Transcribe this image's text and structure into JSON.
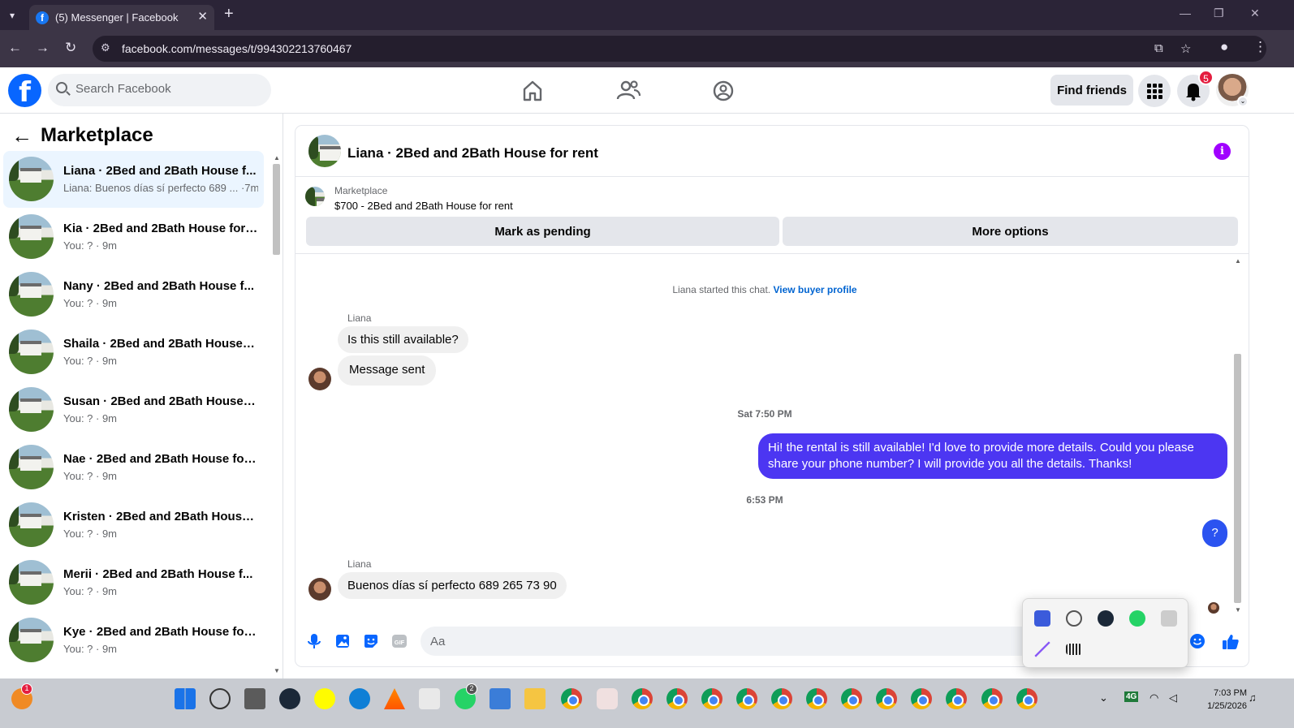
{
  "browser": {
    "tab_title": "(5) Messenger | Facebook",
    "tab_close": "✕",
    "new_tab": "+",
    "url": "facebook.com/messages/t/994302213760467"
  },
  "fb": {
    "logo": "f",
    "search_placeholder": "Search Facebook",
    "find_friends": "Find friends",
    "notif_count": "5"
  },
  "sidebar": {
    "title": "Marketplace",
    "conversations": [
      {
        "name": "Liana · 2Bed and 2Bath House f...",
        "preview": "Liana: Buenos días sí perfecto 689 ... ·7m",
        "active": true
      },
      {
        "name": "Kia · 2Bed and 2Bath House for ...",
        "preview": "You: ? · 9m"
      },
      {
        "name": "Nany · 2Bed and 2Bath House f...",
        "preview": "You: ? · 9m"
      },
      {
        "name": "Shaila · 2Bed and 2Bath House f...",
        "preview": "You: ? · 9m"
      },
      {
        "name": "Susan · 2Bed and 2Bath House f...",
        "preview": "You: ? · 9m"
      },
      {
        "name": "Nae · 2Bed and 2Bath House for...",
        "preview": "You: ? · 9m"
      },
      {
        "name": "Kristen · 2Bed and 2Bath House ...",
        "preview": "You: ? · 9m"
      },
      {
        "name": "Merii · 2Bed and 2Bath House f...",
        "preview": "You: ? · 9m"
      },
      {
        "name": "Kye · 2Bed and 2Bath House for ...",
        "preview": "You: ? · 9m"
      }
    ]
  },
  "chat": {
    "title": "Liana · 2Bed and 2Bath House for rent",
    "listing_caption": "Marketplace",
    "listing_title": "$700 - 2Bed and 2Bath House for rent",
    "mark_pending": "Mark as pending",
    "more_options": "More options",
    "system_text": "Liana started this chat. ",
    "view_buyer": "View buyer profile",
    "sender_name": "Liana",
    "msg1": "Is this still available?",
    "msg2": "Message sent",
    "time1": "Sat 7:50 PM",
    "out_msg": "Hi! the rental is still available! I'd love to provide more details. Could you please share your phone number? I will provide you all the details. Thanks!",
    "time2": "6:53 PM",
    "q_msg": "?",
    "msg3": "Buenos días sí perfecto 689 265 73 90",
    "composer_placeholder": "Aa",
    "gif": "GIF"
  },
  "taskbar": {
    "time": "7:03 PM",
    "date": "1/25/2026",
    "network": "4G",
    "whatsapp_badge": "2",
    "app_badge": "1"
  }
}
